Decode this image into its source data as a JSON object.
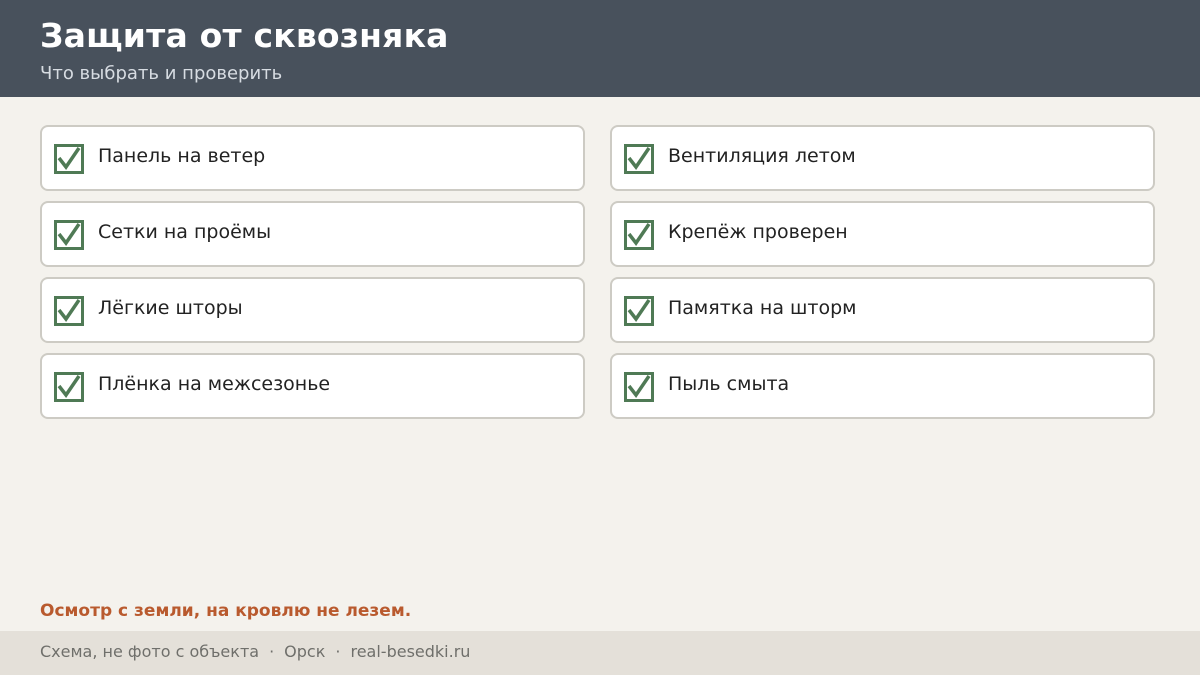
{
  "header": {
    "title": "Защита от сквозняка",
    "subtitle": "Что выбрать и проверить"
  },
  "checklist": {
    "items": [
      {
        "label": "Панель на ветер",
        "checked": true
      },
      {
        "label": "Вентиляция летом",
        "checked": true
      },
      {
        "label": "Сетки на проёмы",
        "checked": true
      },
      {
        "label": "Крепёж проверен",
        "checked": true
      },
      {
        "label": "Лёгкие шторы",
        "checked": true
      },
      {
        "label": "Памятка на шторм",
        "checked": true
      },
      {
        "label": "Плёнка на межсезонье",
        "checked": true
      },
      {
        "label": "Пыль смыта",
        "checked": true
      }
    ]
  },
  "note": "Осмотр с земли, на кровлю не лезем.",
  "footer": {
    "caption": "Схема, не фото с объекта",
    "separator": "·",
    "city": "Орск",
    "site": "real-besedki.ru"
  },
  "colors": {
    "header_bg": "#48515c",
    "page_bg": "#f4f2ed",
    "check_green": "#4f7a55",
    "note_orange": "#b95a2e",
    "footer_bg": "#e4e0d9"
  },
  "icons": {
    "check": "checkbox-checked-icon"
  }
}
